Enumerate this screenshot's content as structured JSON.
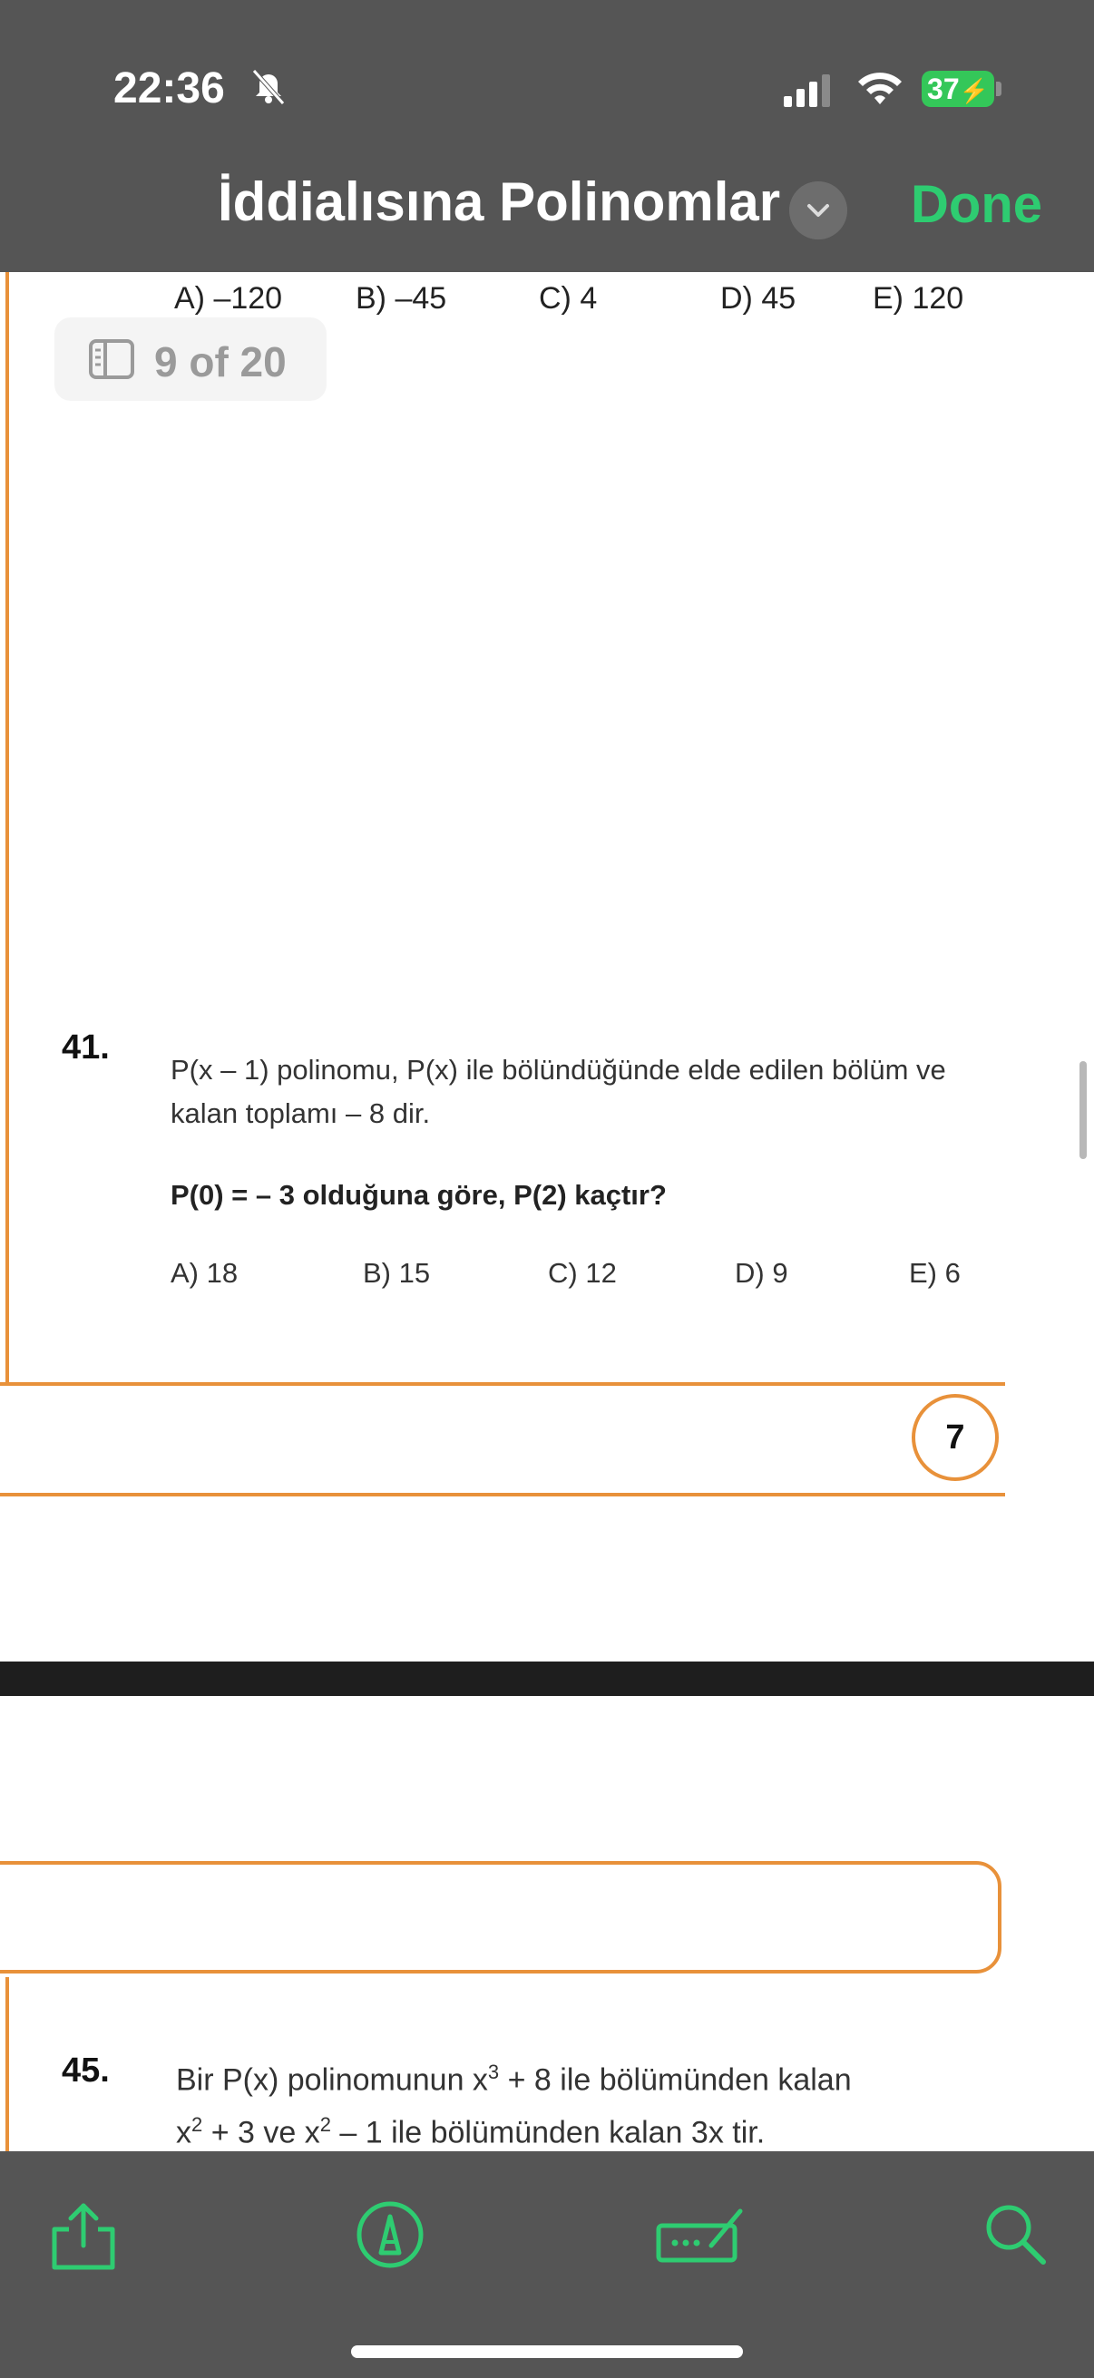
{
  "status_bar": {
    "time": "22:36",
    "battery": "37"
  },
  "header": {
    "title": "İddialısına Polinomlar",
    "done_label": "Done"
  },
  "page_counter": {
    "text": "9 of 20"
  },
  "prev_answers": [
    "A) –120",
    "B) –45",
    "C) 4",
    "D) 45",
    "E) 120"
  ],
  "question41": {
    "number": "41.",
    "line1": "P(x – 1) polinomu, P(x) ile bölündüğünde elde edilen bölüm ve",
    "line2": "kalan toplamı – 8 dir.",
    "prompt": "P(0) = – 3 olduğuna göre,  P(2)  kaçtır?",
    "answers": [
      "A) 18",
      "B) 15",
      "C) 12",
      "D) 9",
      "E) 6"
    ]
  },
  "page_number": "7",
  "question45": {
    "number": "45.",
    "line1_a": "Bir  P(x)  polinomunun  x",
    "line1_sup": "3",
    "line1_b": " + 8  ile bölümünden kalan",
    "line2_a": "x",
    "line2_sup1": "2",
    "line2_b": " + 3  ve  x",
    "line2_sup2": "2",
    "line2_c": " – 1  ile bölümünden kalan  3x tir."
  },
  "toolbar": {
    "icons": [
      "share-icon",
      "markup-icon",
      "annotate-icon",
      "search-icon"
    ]
  },
  "colors": {
    "accent": "#2ecc71",
    "bar": "#555555",
    "orange": "#e8913a"
  }
}
